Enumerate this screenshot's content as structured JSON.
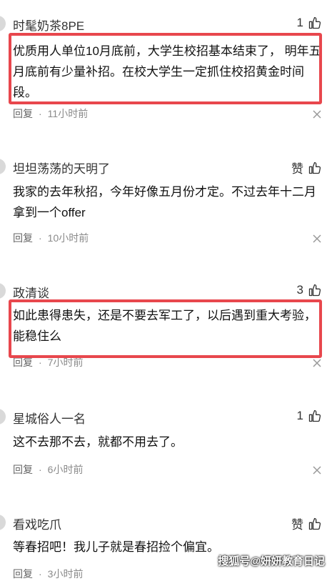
{
  "comments": [
    {
      "name": "时髦奶茶8PE",
      "like": "1",
      "content": "优质用人单位10月底前，大学生校招基本结束了， 明年五月底前有少量补招。在校大学生一定抓住校招黄金时间段。",
      "reply": "回复",
      "dot": "·",
      "time": "11小时前"
    },
    {
      "name": "坦坦荡荡的天明了",
      "like": "赞",
      "content": "我家的去年秋招，今年好像五月份才定。不过去年十二月拿到一个offer",
      "reply": "回复",
      "dot": "·",
      "time": "10小时前"
    },
    {
      "name": "政清谈",
      "like": "3",
      "content": "如此患得患失，还是不要去军工了，以后遇到重大考验，能稳住么",
      "reply": "回复",
      "dot": "·",
      "time": "7小时前"
    },
    {
      "name": "星城俗人一名",
      "like": "1",
      "content": "这不去那不去，就都不用去了。",
      "reply": "回复",
      "dot": "·",
      "time": "6小时前"
    },
    {
      "name": "看戏吃爪",
      "like": "赞",
      "content": "等春招吧！我儿子就是春招捡个偏宜。",
      "reply": "回复",
      "dot": "·",
      "time": "3小时前"
    }
  ],
  "watermark": "搜狐号@妍妍教育日记",
  "colors": {
    "highlight": "#e8474d",
    "meta": "#8a8a8a"
  },
  "icons": {
    "like": "thumbs-up-icon",
    "close": "close-icon"
  }
}
